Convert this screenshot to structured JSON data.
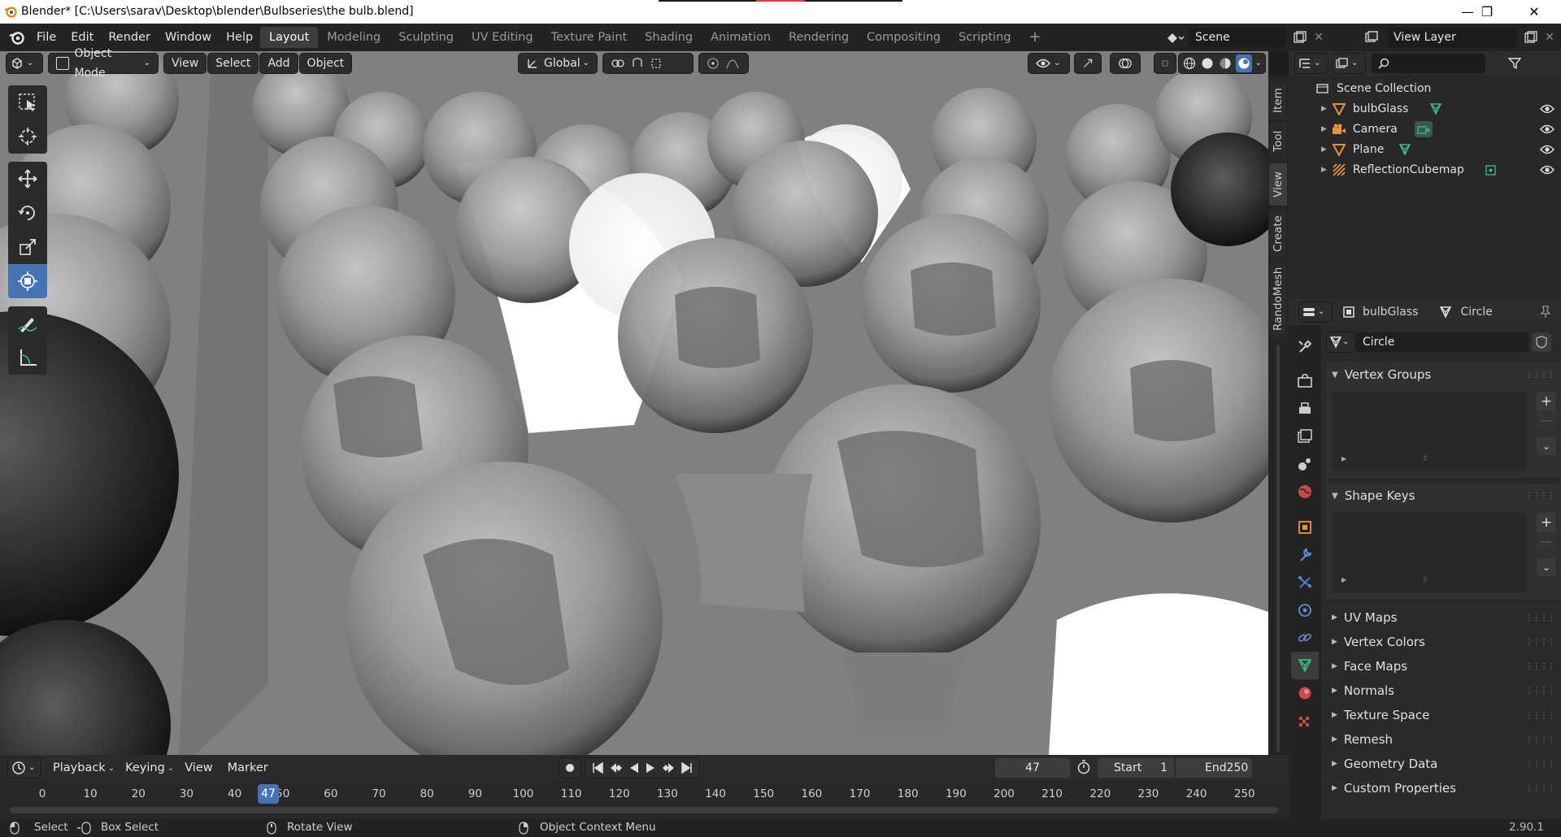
{
  "titlebar": {
    "title": "Blender* [C:\\Users\\sarav\\Desktop\\blender\\Bulbseries\\the bulb.blend]",
    "minimize": "—",
    "maximize": "❐",
    "close": "✕"
  },
  "menu": [
    "File",
    "Edit",
    "Render",
    "Window",
    "Help"
  ],
  "workspaces": [
    {
      "label": "Layout",
      "active": true
    },
    {
      "label": "Modeling"
    },
    {
      "label": "Sculpting"
    },
    {
      "label": "UV Editing"
    },
    {
      "label": "Texture Paint"
    },
    {
      "label": "Shading"
    },
    {
      "label": "Animation"
    },
    {
      "label": "Rendering"
    },
    {
      "label": "Compositing"
    },
    {
      "label": "Scripting"
    }
  ],
  "add_workspace": "+",
  "scene": {
    "label": "Scene"
  },
  "view_layer": {
    "label": "View Layer"
  },
  "viewport_header": {
    "mode": "Object Mode",
    "menus": [
      "View",
      "Select",
      "Add",
      "Object"
    ],
    "transform_orientation": "Global"
  },
  "side_tabs": [
    "Item",
    "Tool",
    "View",
    "Create",
    "RandoMesh"
  ],
  "outliner": {
    "root": "Scene Collection",
    "items": [
      {
        "name": "bulbGlass",
        "type": "mesh"
      },
      {
        "name": "Camera",
        "type": "camera"
      },
      {
        "name": "Plane",
        "type": "mesh"
      },
      {
        "name": "ReflectionCubemap",
        "type": "probe"
      }
    ]
  },
  "properties": {
    "object_name": "bulbGlass",
    "data_name": "Circle",
    "mesh_field": "Circle",
    "panels_open": [
      "Vertex Groups",
      "Shape Keys"
    ],
    "panels_closed": [
      "UV Maps",
      "Vertex Colors",
      "Face Maps",
      "Normals",
      "Texture Space",
      "Remesh",
      "Geometry Data",
      "Custom Properties"
    ]
  },
  "timeline": {
    "menus": [
      "Playback",
      "Keying",
      "View",
      "Marker"
    ],
    "current_frame": "47",
    "start_label": "Start",
    "start": "1",
    "end_label": "End",
    "end": "250",
    "ticks": [
      "0",
      "10",
      "20",
      "30",
      "40",
      "50",
      "60",
      "70",
      "80",
      "90",
      "100",
      "110",
      "120",
      "130",
      "140",
      "150",
      "160",
      "170",
      "180",
      "190",
      "200",
      "210",
      "220",
      "230",
      "240",
      "250"
    ],
    "playhead": "47"
  },
  "statusbar": {
    "select": "Select",
    "box_select": "Box Select",
    "rotate": "Rotate View",
    "context_menu": "Object Context Menu",
    "version": "2.90.1"
  },
  "colors": {
    "accent": "#4772b3",
    "mesh": "#e8923e",
    "data_green": "#3fb77d",
    "bg": "#1d1d1d"
  }
}
